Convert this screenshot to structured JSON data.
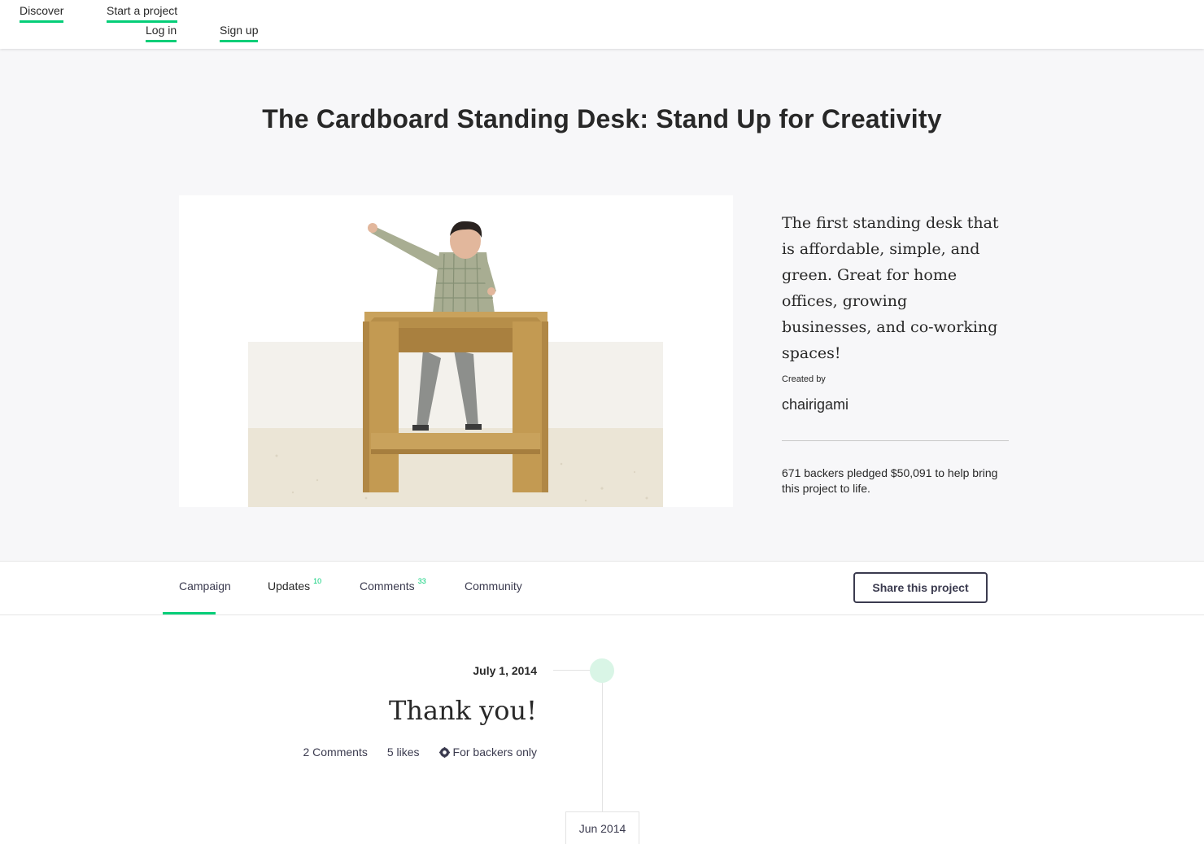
{
  "nav": {
    "discover": "Discover",
    "start_project": "Start a project",
    "log_in": "Log in",
    "sign_up": "Sign up"
  },
  "project": {
    "title": "The Cardboard Standing Desk: Stand Up for Creativity",
    "blurb": "The first standing desk that is affordable, simple, and green. Great for home offices, growing businesses, and co-working spaces!",
    "created_by_label": "Created by",
    "creator": "chairigami",
    "pledge_summary": "671 backers pledged $50,091 to help bring this project to life."
  },
  "tabs": {
    "campaign": "Campaign",
    "updates": "Updates",
    "updates_count": "10",
    "comments": "Comments",
    "comments_count": "33",
    "community": "Community",
    "share_button": "Share this project"
  },
  "update": {
    "date": "July 1, 2014",
    "title": "Thank you!",
    "comments": "2 Comments",
    "likes": "5 likes",
    "visibility": "For backers only",
    "visibility_icon": "lock-icon"
  },
  "timeline": {
    "month": "Jun 2014"
  },
  "colors": {
    "accent": "#05ce78",
    "hero_bg": "#f7f7f9",
    "cardboard": "#c39a52"
  }
}
